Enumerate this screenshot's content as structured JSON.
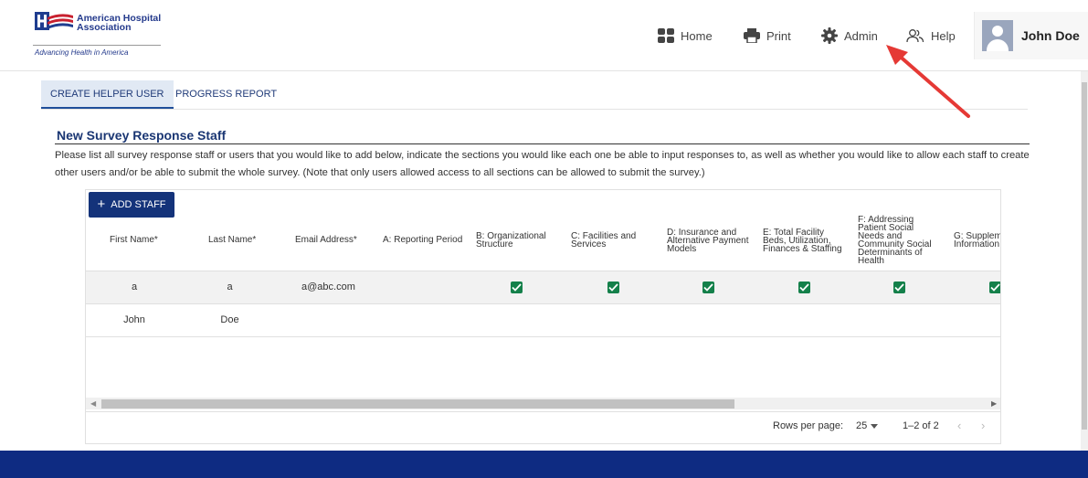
{
  "header": {
    "logo_name_line1": "American Hospital",
    "logo_name_line2": "Association",
    "logo_tagline": "Advancing Health in America",
    "nav": {
      "home": "Home",
      "print": "Print",
      "admin": "Admin",
      "help": "Help"
    },
    "user_name": "John Doe"
  },
  "tabs": [
    {
      "label": "CREATE HELPER USER",
      "active": true
    },
    {
      "label": "PROGRESS REPORT",
      "active": false
    }
  ],
  "section": {
    "title": "New Survey Response Staff",
    "description": "Please list all survey response staff or users that you would like to add below, indicate the sections you would like each one be able to input responses to, as well as whether you would like to allow each staff to create other users and/or be able to submit the whole survey. (Note that only users allowed access to all sections can be allowed to submit the survey.)"
  },
  "grid": {
    "add_button": "ADD STAFF",
    "columns": {
      "first_name": "First Name*",
      "last_name": "Last Name*",
      "email": "Email Address*",
      "a": "A: Reporting Period",
      "b1": "B: Organizational",
      "b2": "Structure",
      "c1": "C: Facilities and",
      "c2": "Services",
      "d1": "D: Insurance and",
      "d2": "Alternative Payment",
      "d3": "Models",
      "e1": "E: Total Facility",
      "e2": "Beds, Utilization,",
      "e3": "Finances & Staffing",
      "f1": "F: Addressing",
      "f2": "Patient Social",
      "f3": "Needs and",
      "f4": "Community Social",
      "f5": "Determinants of",
      "f6": "Health",
      "g1": "G: Supplem",
      "g2": "Information"
    },
    "rows": [
      {
        "first": "a",
        "last": "a",
        "email": "a@abc.com",
        "b": true,
        "c": true,
        "d": true,
        "e": true,
        "f": true,
        "g": true
      },
      {
        "first": "John",
        "last": "Doe",
        "email": "",
        "b": false,
        "c": false,
        "d": false,
        "e": false,
        "f": false,
        "g": false
      }
    ],
    "pagination": {
      "rows_per_page_label": "Rows per page:",
      "rows_per_page_value": "25",
      "range": "1–2 of 2",
      "prev": "‹",
      "next": "›"
    }
  },
  "colors": {
    "brand_navy": "#14337a",
    "footer_navy": "#0e2b82",
    "checkbox_green": "#14804a",
    "annotation_arrow": "#e53935"
  }
}
